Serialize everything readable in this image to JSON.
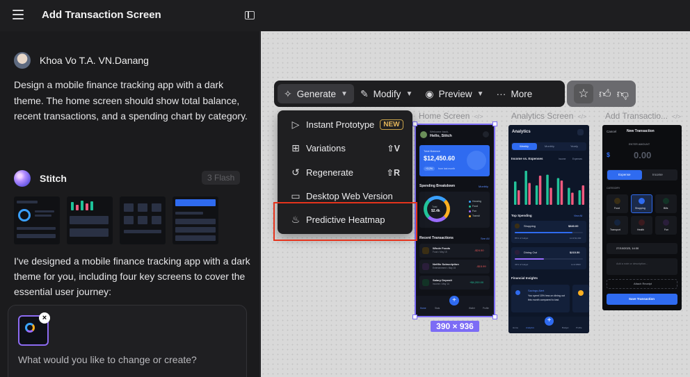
{
  "topbar": {
    "title": "Add Transaction Screen"
  },
  "chat": {
    "user_name": "Khoa Vo T.A. VN.Danang",
    "user_prompt": "Design a mobile finance tracking app with a dark theme. The home screen should show total balance, recent transactions, and a spending chart by category.",
    "assistant_name": "Stitch",
    "model_badge": "3 Flash",
    "assistant_reply": "I've designed a mobile finance tracking app with a dark theme for you, including four key screens to cover the essential user journey:",
    "input_placeholder": "What would you like to change or create?",
    "attachment_close": "×"
  },
  "toolbar": {
    "generate": "Generate",
    "modify": "Modify",
    "preview": "Preview",
    "more": "More"
  },
  "dropdown": {
    "items": [
      {
        "label": "Instant Prototype",
        "badge": "NEW",
        "shortcut": ""
      },
      {
        "label": "Variations",
        "badge": "",
        "shortcut": "⇧V"
      },
      {
        "label": "Regenerate",
        "badge": "",
        "shortcut": "⇧R"
      },
      {
        "label": "Desktop Web Version",
        "badge": "",
        "shortcut": ""
      },
      {
        "label": "Predictive Heatmap",
        "badge": "",
        "shortcut": ""
      }
    ]
  },
  "canvas": {
    "screens": [
      {
        "label": "Home Screen"
      },
      {
        "label": "Analytics Screen"
      },
      {
        "label": "Add Transactio..."
      }
    ],
    "selection_size": "390 × 936"
  },
  "home": {
    "greeting_small": "Welcome back,",
    "greeting": "Hello, Stitch",
    "balance_label": "Total Balance",
    "balance": "$12,450.60",
    "change": "+3.2%",
    "change_note": "from last month",
    "spending_title": "Spending Breakdown",
    "spending_period": "Monthly",
    "donut_total_label": "Total",
    "donut_total": "$2.4k",
    "legend": [
      "Housing",
      "Food",
      "Fun",
      "Transit"
    ],
    "recent_title": "Recent Transactions",
    "see_all": "See All",
    "transactions": [
      {
        "name": "Whole Foods",
        "sub": "Food • May 15",
        "amount": "-$24.50"
      },
      {
        "name": "Netflix Subscription",
        "sub": "Entertainment • May 15",
        "amount": "-$15.99"
      },
      {
        "name": "Salary Deposit",
        "sub": "Income • May 14",
        "amount": "+$4,200.00"
      }
    ],
    "nav": [
      "Home",
      "Stats",
      "",
      "Wallet",
      "Profile"
    ]
  },
  "analytics": {
    "title": "Analytics",
    "tabs": [
      "Weekly",
      "Monthly",
      "Yearly"
    ],
    "income_title": "Income vs. Expenses",
    "legend_income": "Income",
    "legend_expense": "Expenses",
    "top_title": "Top Spending",
    "view_all": "View All",
    "items": [
      {
        "name": "Shopping",
        "amount": "$840.00",
        "sub": "85% of budget",
        "limit": "Limit $1,000"
      },
      {
        "name": "Dining Out",
        "amount": "$215.50",
        "sub": "43% of budget",
        "limit": "Limit $500"
      }
    ],
    "insights_title": "Financial Insights",
    "insight_title": "Savings Alert",
    "insight_text": "You spent 15% less on dining out this month compared to last.",
    "nav": [
      "Home",
      "Analytics",
      "",
      "Budget",
      "Profile"
    ]
  },
  "addtx": {
    "cancel": "Cancel",
    "title": "New Transaction",
    "amount_label": "ENTER AMOUNT",
    "currency": "$",
    "amount": "0.00",
    "type_expense": "Expense",
    "type_income": "Income",
    "category_label": "CATEGORY",
    "categories": [
      "Food",
      "Shopping",
      "Bills",
      "Transport",
      "Health",
      "Fun"
    ],
    "date": "27/10/2023, 14:30",
    "note_placeholder": "Add a note or description...",
    "receipt": "Attach Receipt",
    "save": "Save Transaction"
  },
  "chart_data": {
    "type": "bar",
    "categories": [
      "1",
      "2",
      "3",
      "4",
      "5",
      "6",
      "7"
    ],
    "series": [
      {
        "name": "Income",
        "values": [
          48,
          70,
          40,
          62,
          55,
          35,
          30
        ]
      },
      {
        "name": "Expenses",
        "values": [
          30,
          45,
          60,
          35,
          50,
          25,
          40
        ]
      }
    ],
    "title": "Income vs. Expenses",
    "xlabel": "",
    "ylabel": "",
    "ylim": [
      0,
      80
    ]
  },
  "colors": {
    "accent": "#7c6cf5",
    "highlight_box": "#e5331c",
    "income": "#22c39a",
    "expense": "#f05a7e",
    "primary_blue": "#2f6bf0"
  }
}
